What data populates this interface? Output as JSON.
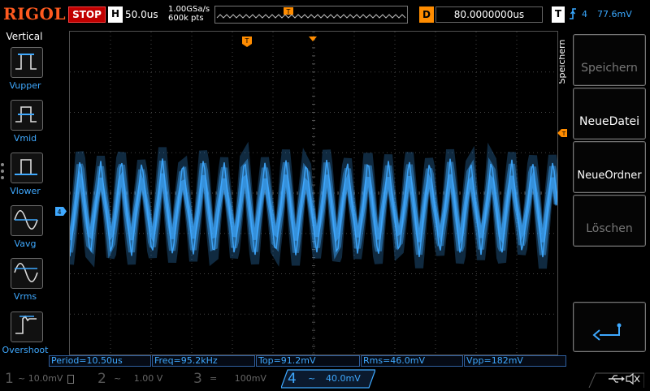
{
  "top": {
    "logo": "RIGOL",
    "run_state": "STOP",
    "horizontal": {
      "label": "H",
      "timebase": "50.0us"
    },
    "sample_rate": "1.00GSa/s",
    "memory_depth": "600k pts",
    "delay": {
      "label": "D",
      "value": "80.0000000us"
    },
    "trigger": {
      "label": "T",
      "channel": "4",
      "level": "77.6mV"
    }
  },
  "left_menu": {
    "title": "Vertical",
    "items": [
      {
        "label": "Vupper"
      },
      {
        "label": "Vmid"
      },
      {
        "label": "Vlower"
      },
      {
        "label": "Vavg"
      },
      {
        "label": "Vrms"
      },
      {
        "label": "Overshoot"
      }
    ]
  },
  "right_menu": {
    "title": "Speichern",
    "items": [
      {
        "label": "Speichern",
        "enabled": false
      },
      {
        "label": "NeueDatei",
        "enabled": true
      },
      {
        "label": "NeueOrdner",
        "enabled": true
      },
      {
        "label": "Löschen",
        "enabled": false
      },
      {
        "label": "",
        "icon": "return-arrow-icon"
      }
    ]
  },
  "measurements": [
    "Period=10.50us",
    "Freq=95.2kHz",
    "Top=91.2mV",
    "Rms=46.0mV",
    "Vpp=182mV"
  ],
  "channels": [
    {
      "num": "1",
      "scale": "10.0mV",
      "color": "#e8e800",
      "active": false
    },
    {
      "num": "2",
      "scale": "1.00 V",
      "color": "#00e0e0",
      "active": false
    },
    {
      "num": "3",
      "scale": "100mV",
      "color": "#e000e0",
      "active": false
    },
    {
      "num": "4",
      "scale": "40.0mV",
      "color": "#3fa9ff",
      "active": true
    }
  ],
  "markers": {
    "channel_marker": "4",
    "trigger_marker": "T"
  },
  "colors": {
    "ch4": "#3fa9ff",
    "accent_orange": "#ff8c00",
    "stop_red": "#c00000"
  }
}
